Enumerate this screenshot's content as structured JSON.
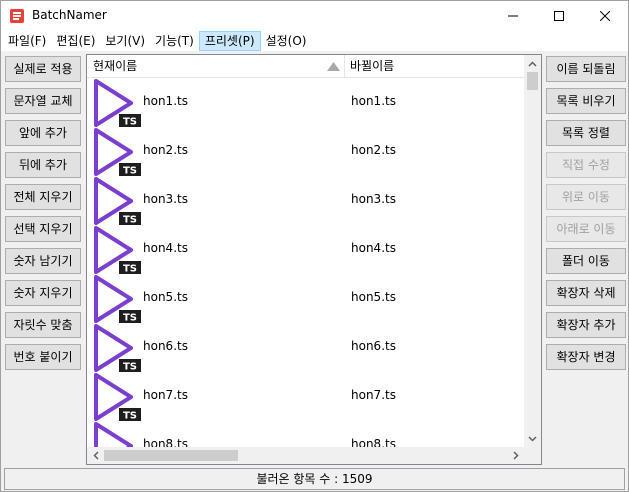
{
  "window": {
    "title": "BatchNamer",
    "controls": {
      "minimize_icon": "minimize-icon",
      "maximize_icon": "maximize-icon",
      "close_icon": "close-icon"
    }
  },
  "menu": [
    {
      "label": "파일(F)",
      "active": false
    },
    {
      "label": "편집(E)",
      "active": false
    },
    {
      "label": "보기(V)",
      "active": false
    },
    {
      "label": "기능(T)",
      "active": false
    },
    {
      "label": "프리셋(P)",
      "active": true
    },
    {
      "label": "설정(O)",
      "active": false
    }
  ],
  "left_buttons": [
    {
      "label": "실제로 적용",
      "enabled": true
    },
    {
      "label": "문자열 교체",
      "enabled": true
    },
    {
      "label": "앞에 추가",
      "enabled": true
    },
    {
      "label": "뒤에 추가",
      "enabled": true
    },
    {
      "label": "전체 지우기",
      "enabled": true
    },
    {
      "label": "선택 지우기",
      "enabled": true
    },
    {
      "label": "숫자 남기기",
      "enabled": true
    },
    {
      "label": "숫자 지우기",
      "enabled": true
    },
    {
      "label": "자릿수 맞춤",
      "enabled": true
    },
    {
      "label": "번호 붙이기",
      "enabled": true
    }
  ],
  "right_buttons": [
    {
      "label": "이름 되돌림",
      "enabled": true
    },
    {
      "label": "목록 비우기",
      "enabled": true
    },
    {
      "label": "목록 정렬",
      "enabled": true
    },
    {
      "label": "직접 수정",
      "enabled": false
    },
    {
      "label": "위로 이동",
      "enabled": false
    },
    {
      "label": "아래로 이동",
      "enabled": false
    },
    {
      "label": "폴더 이동",
      "enabled": true
    },
    {
      "label": "확장자 삭제",
      "enabled": true
    },
    {
      "label": "확장자 추가",
      "enabled": true
    },
    {
      "label": "확장자 변경",
      "enabled": true
    }
  ],
  "list": {
    "columns": {
      "current": "현재이름",
      "renamed": "바뀔이름"
    },
    "icon_badge": "TS",
    "rows": [
      {
        "current": "hon1.ts",
        "renamed": "hon1.ts"
      },
      {
        "current": "hon2.ts",
        "renamed": "hon2.ts"
      },
      {
        "current": "hon3.ts",
        "renamed": "hon3.ts"
      },
      {
        "current": "hon4.ts",
        "renamed": "hon4.ts"
      },
      {
        "current": "hon5.ts",
        "renamed": "hon5.ts"
      },
      {
        "current": "hon6.ts",
        "renamed": "hon6.ts"
      },
      {
        "current": "hon7.ts",
        "renamed": "hon7.ts"
      },
      {
        "current": "hon8.ts",
        "renamed": "hon8.ts"
      }
    ]
  },
  "status": {
    "text": "불러온 항목 수 : 1509"
  },
  "colors": {
    "accent_icon": "#7b3fd0",
    "badge_bg": "#1e1e1e",
    "menu_highlight": "#cce8ff"
  }
}
